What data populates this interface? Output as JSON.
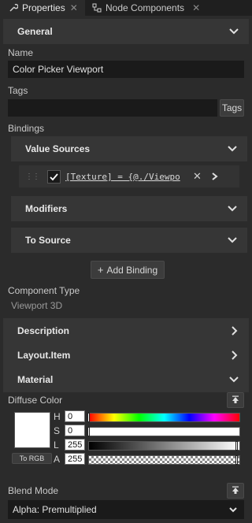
{
  "tabs": [
    {
      "label": "Properties",
      "icon": "wrench-icon",
      "active": true
    },
    {
      "label": "Node Components",
      "icon": "components-icon",
      "active": false
    }
  ],
  "general": {
    "header": "General",
    "name_label": "Name",
    "name_value": "Color Picker Viewport",
    "tags_label": "Tags",
    "tags_value": "",
    "tags_button": "Tags",
    "bindings_label": "Bindings",
    "value_sources": "Value Sources",
    "binding_expression": "[Texture] = {@./Viewpo",
    "modifiers": "Modifiers",
    "to_source": "To Source",
    "add_binding": "Add Binding",
    "component_type_label": "Component Type",
    "component_type_value": "Viewport 3D"
  },
  "sections": {
    "description": "Description",
    "layout_item": "Layout.Item",
    "material": "Material"
  },
  "material": {
    "diffuse_label": "Diffuse Color",
    "swatch_color": "#ffffff",
    "to_rgb": "To RGB",
    "h_label": "H",
    "h_value": "0",
    "s_label": "S",
    "s_value": "0",
    "l_label": "L",
    "l_value": "255",
    "a_label": "A",
    "a_value": "255",
    "blend_label": "Blend Mode",
    "blend_value": "Alpha: Premultiplied"
  }
}
